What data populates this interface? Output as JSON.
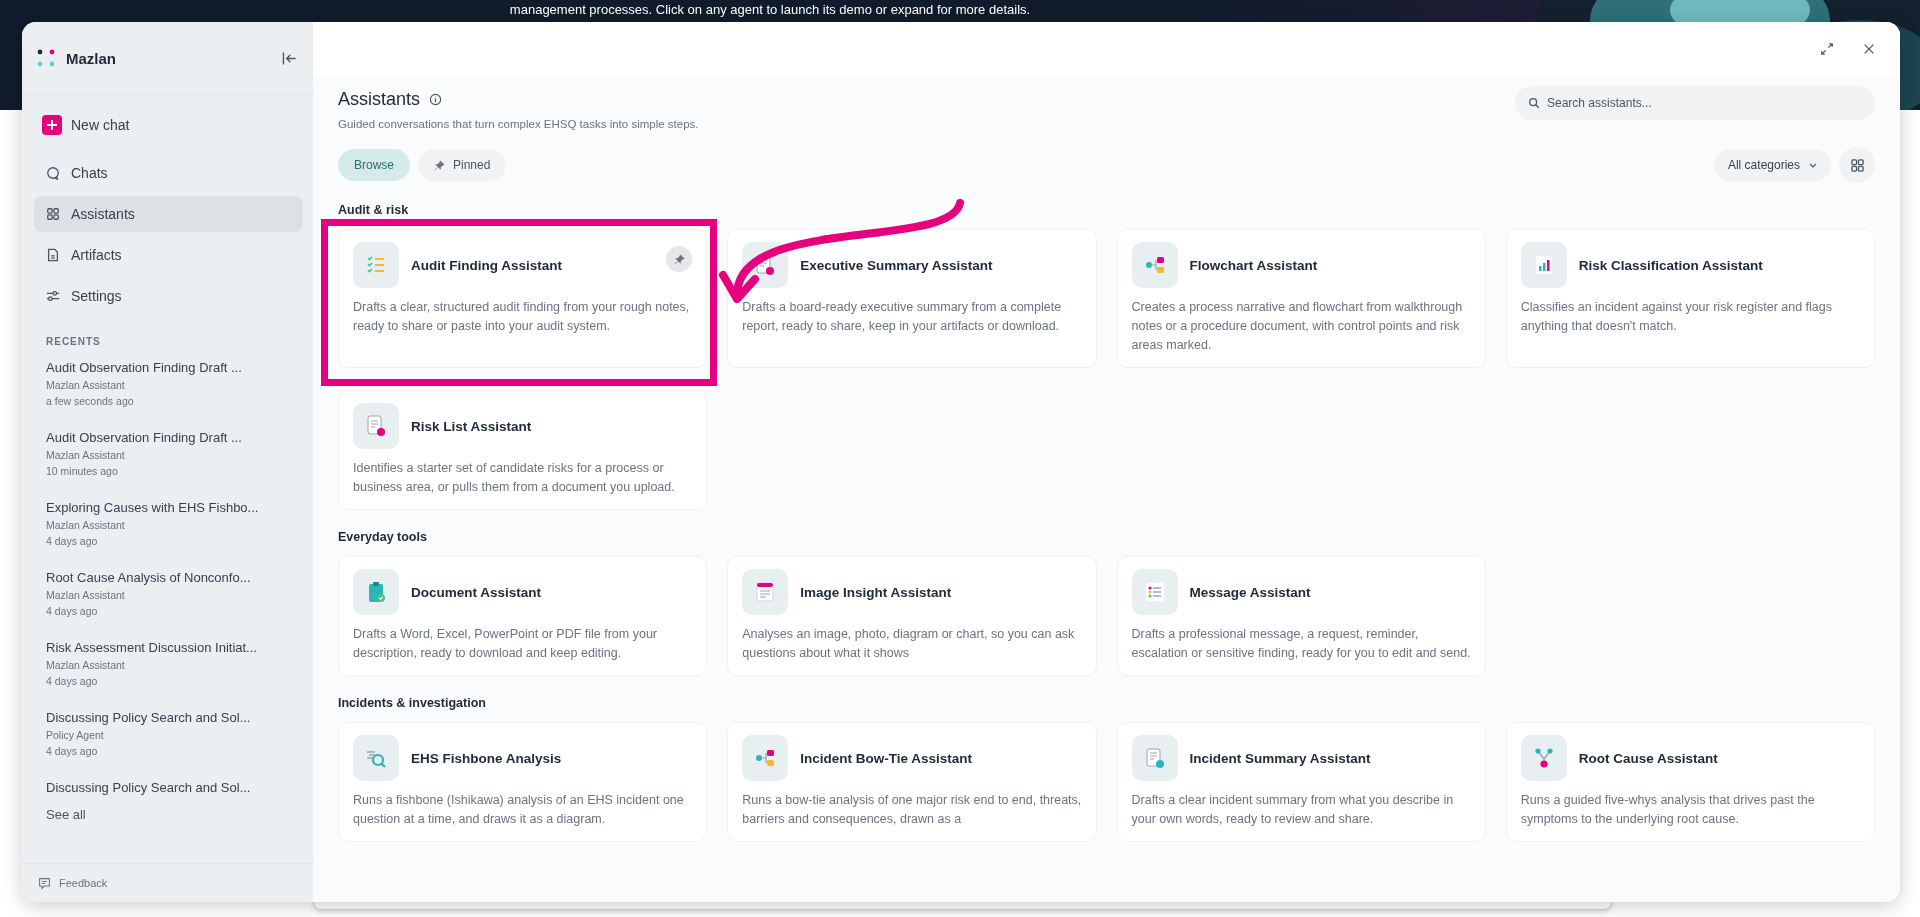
{
  "page": {
    "banner_text": "management processes. Click on any agent to launch its demo or expand for more details."
  },
  "sidebar": {
    "brand": "Mazlan",
    "new_chat": "New chat",
    "nav": [
      {
        "label": "Chats",
        "selected": false
      },
      {
        "label": "Assistants",
        "selected": true
      },
      {
        "label": "Artifacts",
        "selected": false
      },
      {
        "label": "Settings",
        "selected": false
      }
    ],
    "recents_heading": "RECENTS",
    "recents": [
      {
        "title": "Audit Observation Finding Draft ...",
        "agent": "Mazlan Assistant",
        "time": "a few seconds ago"
      },
      {
        "title": "Audit Observation Finding Draft ...",
        "agent": "Mazlan Assistant",
        "time": "10 minutes ago"
      },
      {
        "title": "Exploring Causes with EHS Fishbo...",
        "agent": "Mazlan Assistant",
        "time": "4 days ago"
      },
      {
        "title": "Root Cause Analysis of Nonconfo...",
        "agent": "Mazlan Assistant",
        "time": "4 days ago"
      },
      {
        "title": "Risk Assessment Discussion Initiat...",
        "agent": "Mazlan Assistant",
        "time": "4 days ago"
      },
      {
        "title": "Discussing Policy Search and Sol...",
        "agent": "Policy Agent",
        "time": "4 days ago"
      },
      {
        "title": "Discussing Policy Search and Sol..."
      }
    ],
    "see_all": "See all",
    "feedback": "Feedback"
  },
  "main": {
    "title": "Assistants",
    "subtitle": "Guided conversations that turn complex EHSQ tasks into simple steps.",
    "search": {
      "placeholder": "Search assistants..."
    },
    "filters": [
      {
        "label": "Browse",
        "selected": true
      },
      {
        "label": "Pinned",
        "selected": false
      }
    ],
    "category": "All categories",
    "sections": [
      {
        "heading": "Audit & risk",
        "cards": [
          {
            "title": "Audit Finding Assistant",
            "description": "Drafts a clear, structured audit finding from your rough notes, ready to share or paste into your audit system.",
            "hovered": true,
            "highlighted": true
          },
          {
            "title": "Executive Summary Assistant",
            "description": "Drafts a board-ready executive summary from a complete report, ready to share, keep in your artifacts or download.",
            "hovered": false,
            "highlighted": false
          },
          {
            "title": "Flowchart Assistant",
            "description": "Creates a process narrative and flowchart from walkthrough notes or a procedure document, with control points and risk areas marked.",
            "hovered": false,
            "highlighted": false
          },
          {
            "title": "Risk Classification Assistant",
            "description": "Classifies an incident against your risk register and flags anything that doesn't match.",
            "hovered": false,
            "highlighted": false
          },
          {
            "title": "Risk List Assistant",
            "description": "Identifies a starter set of candidate risks for a process or business area, or pulls them from a document you upload.",
            "hovered": false,
            "highlighted": false
          }
        ]
      },
      {
        "heading": "Everyday tools",
        "cards": [
          {
            "title": "Document Assistant",
            "description": "Drafts a Word, Excel, PowerPoint or PDF file from your description, ready to download and keep editing.",
            "hovered": false,
            "highlighted": false
          },
          {
            "title": "Image Insight Assistant",
            "description": "Analyses an image, photo, diagram or chart, so you can ask questions about what it shows",
            "hovered": false,
            "highlighted": false
          },
          {
            "title": "Message Assistant",
            "description": "Drafts a professional message, a request, reminder, escalation or sensitive finding, ready for you to edit and send.",
            "hovered": false,
            "highlighted": false
          }
        ]
      },
      {
        "heading": "Incidents & investigation",
        "cards": [
          {
            "title": "EHS Fishbone Analysis",
            "description": "Runs a fishbone (Ishikawa) analysis of an EHS incident one question at a time, and draws it as a diagram.",
            "hovered": false,
            "highlighted": false
          },
          {
            "title": "Incident Bow-Tie Assistant",
            "description": "Runs a bow-tie analysis of one major risk end to end, threats, barriers and consequences, drawn as a",
            "hovered": false,
            "highlighted": false
          },
          {
            "title": "Incident Summary Assistant",
            "description": "Drafts a clear incident summary from what you describe in your own words, ready to review and share.",
            "hovered": false,
            "highlighted": false
          },
          {
            "title": "Root Cause Assistant",
            "description": "Runs a guided five-whys analysis that drives past the symptoms to the underlying root cause.",
            "hovered": false,
            "highlighted": false
          }
        ]
      }
    ]
  }
}
